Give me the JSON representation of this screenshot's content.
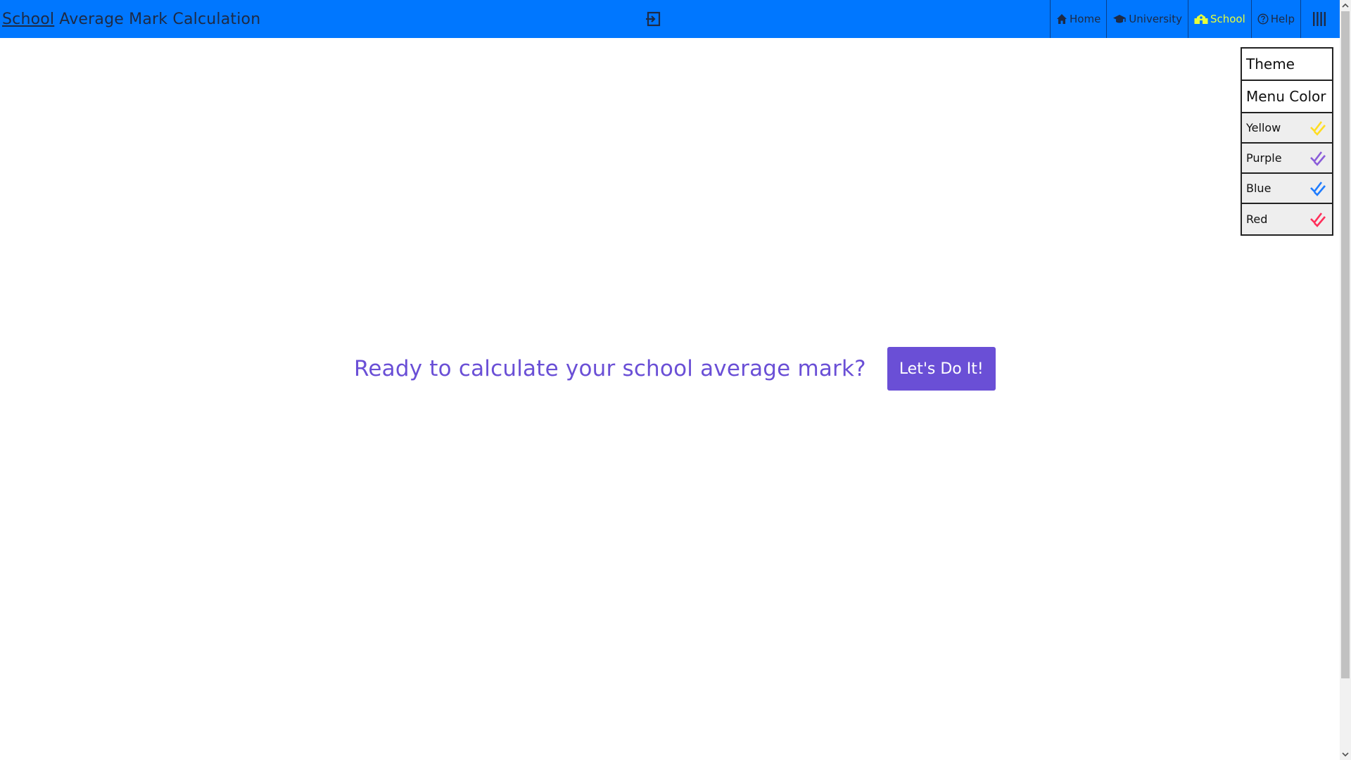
{
  "header": {
    "brand_link": "School",
    "brand_rest": "Average Mark Calculation",
    "exit_icon": "exit-icon",
    "nav": [
      {
        "label": "Home",
        "icon": "home-icon"
      },
      {
        "label": "University",
        "icon": "graduation-cap-icon"
      },
      {
        "label": "School",
        "icon": "school-icon",
        "active": true
      },
      {
        "label": "Help",
        "icon": "help-icon"
      }
    ],
    "menu_icon": "menu-bars-icon"
  },
  "dropdown": {
    "theme_label": "Theme",
    "menu_color_label": "Menu Color",
    "colors": [
      {
        "label": "Yellow",
        "check_color": "#ffdd22"
      },
      {
        "label": "Purple",
        "check_color": "#8a5cd9"
      },
      {
        "label": "Blue",
        "check_color": "#1f7cff"
      },
      {
        "label": "Red",
        "check_color": "#ff2f5a"
      }
    ]
  },
  "main": {
    "prompt": "Ready to calculate your school average mark?",
    "button_label": "Let's Do It!"
  },
  "colors": {
    "topbar": "#0077ff",
    "accent": "#6a4fd6",
    "active_nav": "#e6ff3a"
  }
}
